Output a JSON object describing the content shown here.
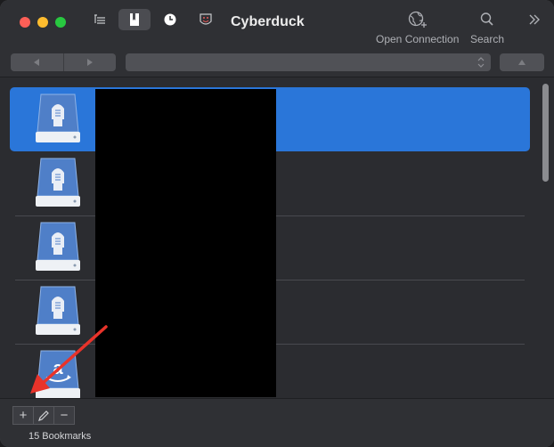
{
  "window": {
    "title": "Cyberduck"
  },
  "toolbar": {
    "open_connection_label": "Open Connection",
    "search_label": "Search"
  },
  "bookmarks": {
    "rows": [
      {
        "icon": "ftp-drive-icon",
        "selected": true
      },
      {
        "icon": "ftp-drive-icon",
        "selected": false
      },
      {
        "icon": "ftp-drive-icon",
        "selected": false
      },
      {
        "icon": "ftp-drive-icon",
        "selected": false
      },
      {
        "icon": "amazon-s3-drive-icon",
        "selected": false
      }
    ]
  },
  "bottombar": {
    "add_label": "+",
    "edit_icon": "pencil-icon",
    "remove_label": "−",
    "status_text": "15 Bookmarks"
  },
  "colors": {
    "selection": "#2a76d9",
    "annotation_arrow": "#e8332a"
  }
}
